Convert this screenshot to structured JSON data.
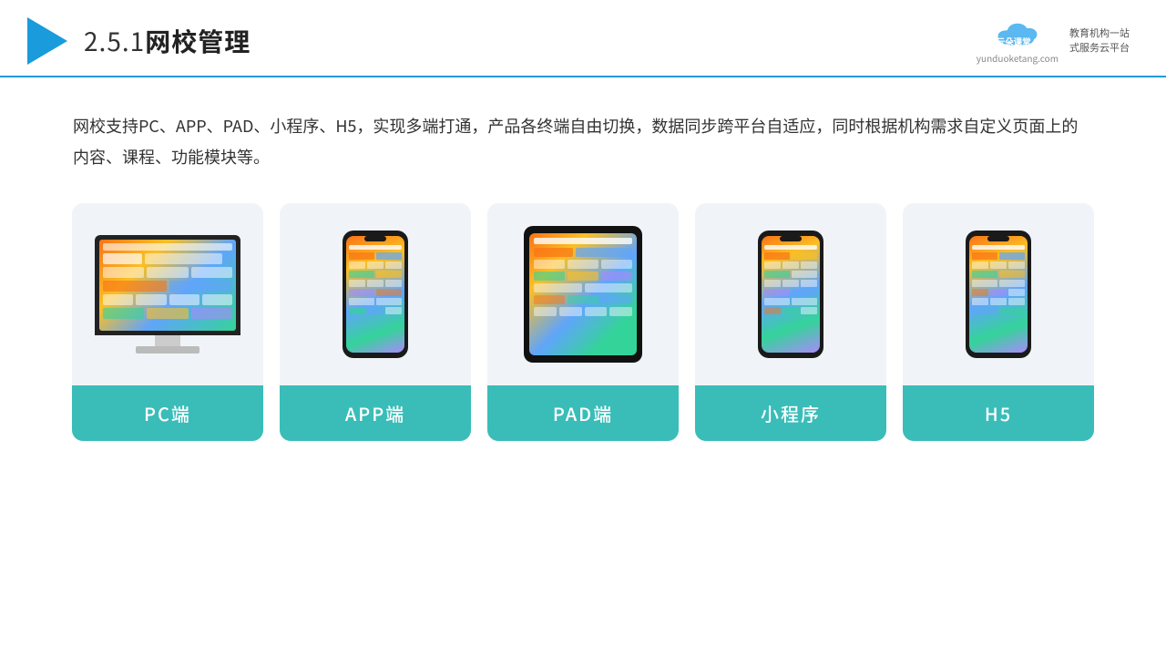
{
  "header": {
    "title": "2.5.1网校管理",
    "title_prefix": "2.5.1",
    "title_main": "网校管理",
    "brand_name": "云朵课堂",
    "brand_url": "yunduoketang.com",
    "brand_slogan": "教育机构一站\n式服务云平台"
  },
  "description": {
    "text": "网校支持PC、APP、PAD、小程序、H5，实现多端打通，产品各终端自由切换，数据同步跨平台自适应，同时根据机构需求自定义页面上的内容、课程、功能模块等。"
  },
  "cards": [
    {
      "id": "pc",
      "label": "PC端"
    },
    {
      "id": "app",
      "label": "APP端"
    },
    {
      "id": "pad",
      "label": "PAD端"
    },
    {
      "id": "miniapp",
      "label": "小程序"
    },
    {
      "id": "h5",
      "label": "H5"
    }
  ]
}
